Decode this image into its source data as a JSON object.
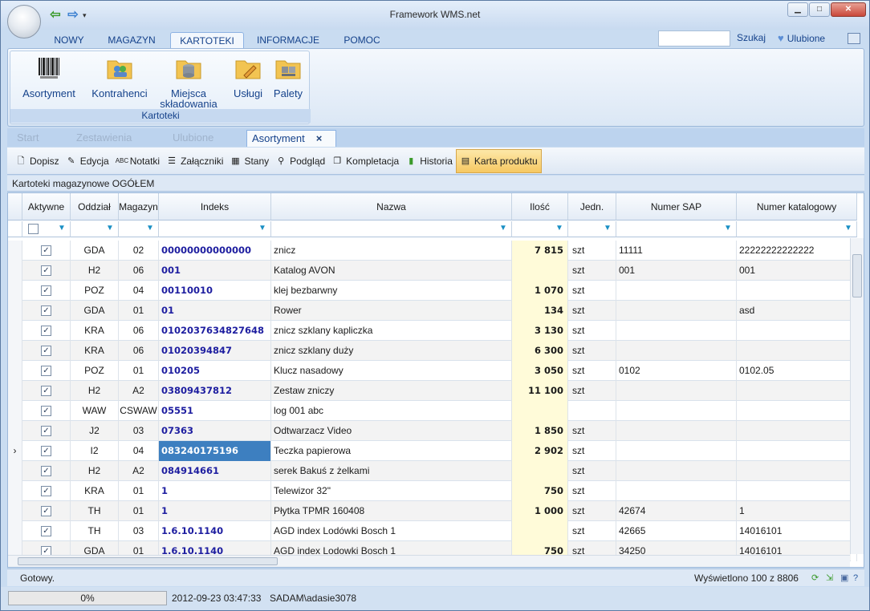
{
  "window": {
    "title": "Framework WMS.net"
  },
  "menu": {
    "tabs": [
      {
        "label": "NOWY"
      },
      {
        "label": "MAGAZYN"
      },
      {
        "label": "KARTOTEKI"
      },
      {
        "label": "INFORMACJE"
      },
      {
        "label": "POMOC"
      }
    ],
    "search_label": "Szukaj",
    "favorites_label": "Ulubione"
  },
  "ribbon": {
    "group_label": "Kartoteki",
    "buttons": [
      {
        "label": "Asortyment",
        "icon": "barcode-icon"
      },
      {
        "label": "Kontrahenci",
        "icon": "folder-people-icon"
      },
      {
        "label": "Miejsca",
        "label2": "składowania",
        "icon": "folder-database-icon"
      },
      {
        "label": "Usługi",
        "icon": "folder-pencil-icon"
      },
      {
        "label": "Palety",
        "icon": "folder-boxes-icon"
      }
    ]
  },
  "doc_tabs": [
    {
      "label": "Start"
    },
    {
      "label": "Zestawienia"
    },
    {
      "label": "Ulubione"
    },
    {
      "label": "Asortyment"
    }
  ],
  "toolbar": [
    {
      "label": "Dopisz",
      "icon": "new-document-icon"
    },
    {
      "label": "Edycja",
      "icon": "edit-icon"
    },
    {
      "label": "Notatki",
      "icon": "spellcheck-icon"
    },
    {
      "label": "Załączniki",
      "icon": "list-icon"
    },
    {
      "label": "Stany",
      "icon": "table-icon"
    },
    {
      "label": "Podgląd",
      "icon": "magnifier-icon"
    },
    {
      "label": "Kompletacja",
      "icon": "documents-icon"
    },
    {
      "label": "Historia",
      "icon": "bars-icon"
    },
    {
      "label": "Karta produktu",
      "icon": "card-icon"
    }
  ],
  "grid": {
    "title": "Kartoteki magazynowe OGÓŁEM",
    "columns": [
      "Aktywne",
      "Oddział",
      "Magazyn",
      "Indeks",
      "Nazwa",
      "Ilość",
      "Jedn.",
      "Numer SAP",
      "Numer katalogowy"
    ],
    "rows": [
      {
        "active": true,
        "branch": "GDA",
        "wh": "02",
        "index": "00000000000000",
        "name": "znicz",
        "qty": "7 815",
        "unit": "szt",
        "sap": "11111",
        "cat": "22222222222222"
      },
      {
        "active": true,
        "branch": "H2",
        "wh": "06",
        "index": "001",
        "name": "Katalog AVON",
        "qty": "",
        "unit": "szt",
        "sap": "001",
        "cat": "001"
      },
      {
        "active": true,
        "branch": "POZ",
        "wh": "04",
        "index": "00110010",
        "name": "klej bezbarwny",
        "qty": "1 070",
        "unit": "szt",
        "sap": "",
        "cat": ""
      },
      {
        "active": true,
        "branch": "GDA",
        "wh": "01",
        "index": "01",
        "name": "Rower",
        "qty": "134",
        "unit": "szt",
        "sap": "",
        "cat": "asd"
      },
      {
        "active": true,
        "branch": "KRA",
        "wh": "06",
        "index": "0102037634827648",
        "name": "znicz szklany kapliczka",
        "qty": "3 130",
        "unit": "szt",
        "sap": "",
        "cat": ""
      },
      {
        "active": true,
        "branch": "KRA",
        "wh": "06",
        "index": "01020394847",
        "name": "znicz szklany duży",
        "qty": "6 300",
        "unit": "szt",
        "sap": "",
        "cat": ""
      },
      {
        "active": true,
        "branch": "POZ",
        "wh": "01",
        "index": "010205",
        "name": "Klucz nasadowy",
        "qty": "3 050",
        "unit": "szt",
        "sap": "0102",
        "cat": "0102.05"
      },
      {
        "active": true,
        "branch": "H2",
        "wh": "A2",
        "index": "03809437812",
        "name": "Zestaw zniczy",
        "qty": "11 100",
        "unit": "szt",
        "sap": "",
        "cat": ""
      },
      {
        "active": true,
        "branch": "WAW",
        "wh": "CSWAW",
        "index": "05551",
        "name": "log 001 abc",
        "qty": "",
        "unit": "",
        "sap": "",
        "cat": ""
      },
      {
        "active": true,
        "branch": "J2",
        "wh": "03",
        "index": "07363",
        "name": "Odtwarzacz Video",
        "qty": "1 850",
        "unit": "szt",
        "sap": "",
        "cat": ""
      },
      {
        "active": true,
        "branch": "I2",
        "wh": "04",
        "index": "083240175196",
        "name": "Teczka papierowa",
        "qty": "2 902",
        "unit": "szt",
        "sap": "",
        "cat": "",
        "selected": true
      },
      {
        "active": true,
        "branch": "H2",
        "wh": "A2",
        "index": "084914661",
        "name": "serek Bakuś z żelkami",
        "qty": "",
        "unit": "szt",
        "sap": "",
        "cat": ""
      },
      {
        "active": true,
        "branch": "KRA",
        "wh": "01",
        "index": "1",
        "name": "Telewizor 32\"",
        "qty": "750",
        "unit": "szt",
        "sap": "",
        "cat": ""
      },
      {
        "active": true,
        "branch": "TH",
        "wh": "01",
        "index": "1",
        "name": "Płytka TPMR 160408",
        "qty": "1 000",
        "unit": "szt",
        "sap": "42674",
        "cat": "1"
      },
      {
        "active": true,
        "branch": "TH",
        "wh": "03",
        "index": "1.6.10.1140",
        "name": "AGD index Lodówki Bosch 1",
        "qty": "",
        "unit": "szt",
        "sap": "42665",
        "cat": "14016101"
      },
      {
        "active": true,
        "branch": "GDA",
        "wh": "01",
        "index": "1.6.10.1140",
        "name": "AGD index Lodowki Bosch 1",
        "qty": "750",
        "unit": "szt",
        "sap": "34250",
        "cat": "14016101"
      }
    ]
  },
  "status": {
    "ready": "Gotowy.",
    "shown": "Wyświetlono 100 z 8806",
    "progress": "0%",
    "progress_value": 0,
    "datetime": "2012-09-23 03:47:33",
    "user": "SADAM\\adasie3078"
  }
}
